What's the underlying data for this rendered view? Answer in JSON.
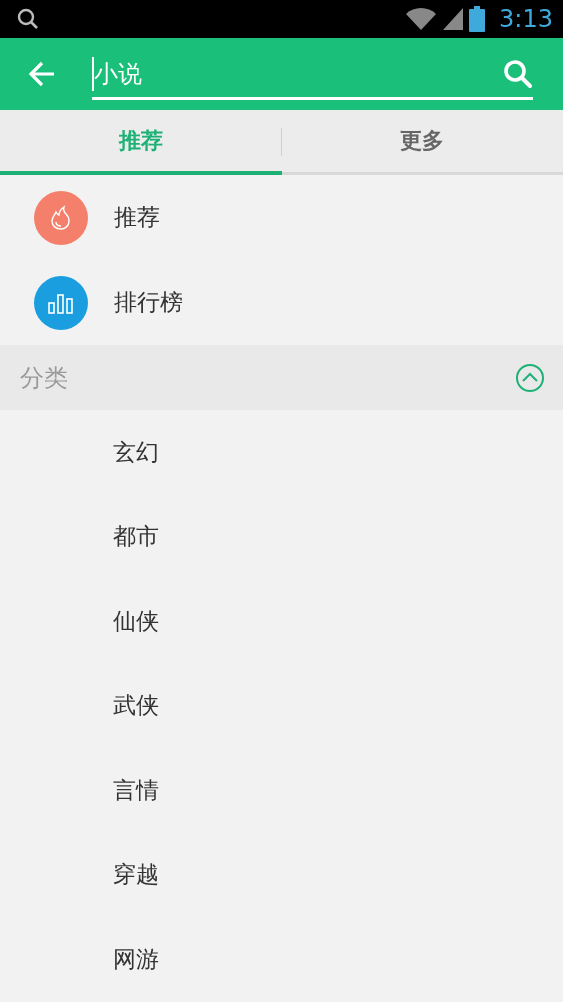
{
  "status_bar": {
    "time": "3:13"
  },
  "search": {
    "value": "小说"
  },
  "tabs": [
    {
      "label": "推荐",
      "selected": true
    },
    {
      "label": "更多",
      "selected": false
    }
  ],
  "entries": [
    {
      "label": "推荐",
      "kind": "hot",
      "color": "#f4806c"
    },
    {
      "label": "排行榜",
      "kind": "chart",
      "color": "#1b9ee0"
    }
  ],
  "category_section": {
    "title": "分类",
    "expanded": true,
    "items": [
      "玄幻",
      "都市",
      "仙侠",
      "武侠",
      "言情",
      "穿越",
      "网游"
    ]
  }
}
